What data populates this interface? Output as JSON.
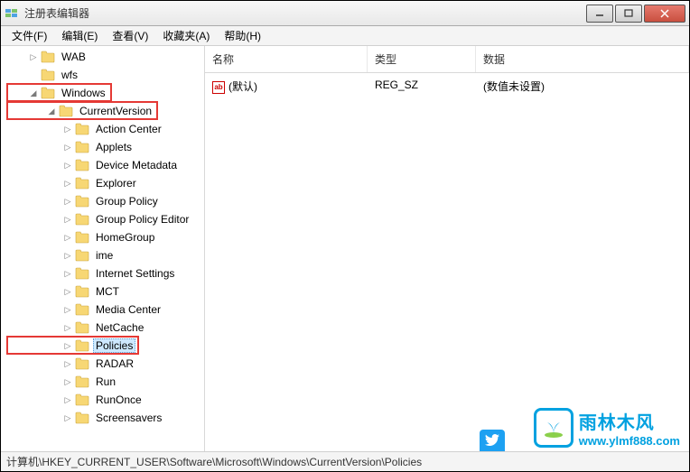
{
  "window": {
    "title": "注册表编辑器"
  },
  "menu": {
    "file": "文件(F)",
    "edit": "编辑(E)",
    "view": "查看(V)",
    "favorites": "收藏夹(A)",
    "help": "帮助(H)"
  },
  "list": {
    "headers": {
      "name": "名称",
      "type": "类型",
      "data": "数据"
    },
    "rows": [
      {
        "name": "(默认)",
        "type": "REG_SZ",
        "data": "(数值未设置)"
      }
    ]
  },
  "tree": {
    "top": [
      {
        "label": "WAB",
        "indent": 2,
        "expander": "▷"
      },
      {
        "label": "wfs",
        "indent": 2,
        "expander": ""
      },
      {
        "label": "Windows",
        "indent": 2,
        "expander": "◢",
        "highlight": true
      },
      {
        "label": "CurrentVersion",
        "indent": 3,
        "expander": "◢",
        "highlight": true
      }
    ],
    "children": [
      "Action Center",
      "Applets",
      "Device Metadata",
      "Explorer",
      "Group Policy",
      "Group Policy Editor",
      "HomeGroup",
      "ime",
      "Internet Settings",
      "MCT",
      "Media Center",
      "NetCache",
      "Policies",
      "RADAR",
      "Run",
      "RunOnce",
      "Screensavers"
    ],
    "selected": "Policies",
    "childHighlight": "Policies"
  },
  "statusbar": {
    "path": "计算机\\HKEY_CURRENT_USER\\Software\\Microsoft\\Windows\\CurrentVersion\\Policies"
  },
  "watermark": {
    "cn": "雨林木风",
    "url": "www.ylmf888.com"
  }
}
